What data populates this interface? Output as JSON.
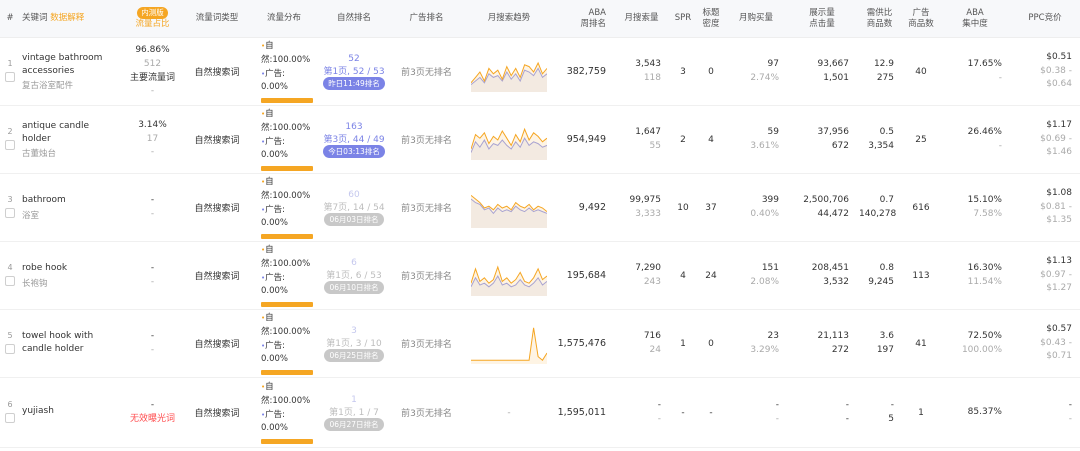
{
  "header": {
    "index": "#",
    "keyword": "关键词",
    "keyword_tag": "数据解释",
    "traffic_share_tag": "内测版",
    "traffic_share": "流量占比",
    "traffic_type": "流量词类型",
    "traffic_dist": "流量分布",
    "organic_rank": "自然排名",
    "ad_rank": "广告排名",
    "monthly_trend": "月搜索趋势",
    "aba_rank_1": "ABA",
    "aba_rank_2": "周排名",
    "monthly_search": "月搜索量",
    "spr": "SPR",
    "title_density_1": "标题",
    "title_density_2": "密度",
    "monthly_purchase": "月购买量",
    "impr_click_1": "展示量",
    "impr_click_2": "点击量",
    "supply_ratio_1": "需供比",
    "supply_ratio_2": "商品数",
    "ad_products_1": "广告",
    "ad_products_2": "商品数",
    "aba_conc_1": "ABA",
    "aba_conc_2": "集中度",
    "ppc": "PPC竞价"
  },
  "rows": [
    {
      "idx": "1",
      "kw": "vintage bathroom accessories",
      "kw_cn": "复古浴室配件",
      "share_pct": "96.86%",
      "share_sub": "512",
      "share_tag": "主要流量词",
      "share_extra": "-",
      "type": "自然搜索词",
      "organic_label": "自然:",
      "organic_pct": "100.00%",
      "ad_label": "广告:",
      "ad_pct": "0.00%",
      "rank_top": "52",
      "rank_page": "第1页, 52 / 53",
      "rank_badge": "昨日11:49排名",
      "ad_rank": "前3页无排名",
      "aba": "382,759",
      "search": "3,543",
      "search_sub": "118",
      "spr": "3",
      "density": "0",
      "purchase": "97",
      "purchase_rate": "2.74%",
      "impr": "93,667",
      "click": "1,501",
      "ratio": "12.9",
      "products": "275",
      "ad_products": "40",
      "conc": "17.65%",
      "conc_sub": "-",
      "ppc": "$0.51",
      "ppc_range": "$0.38 - $0.64"
    },
    {
      "idx": "2",
      "kw": "antique candle holder",
      "kw_cn": "古董烛台",
      "share_pct": "3.14%",
      "share_sub": "17",
      "share_tag": "",
      "share_extra": "-",
      "type": "自然搜索词",
      "organic_label": "自然:",
      "organic_pct": "100.00%",
      "ad_label": "广告:",
      "ad_pct": "0.00%",
      "rank_top": "163",
      "rank_page": "第3页, 44 / 49",
      "rank_badge": "今日03:13排名",
      "ad_rank": "前3页无排名",
      "aba": "954,949",
      "search": "1,647",
      "search_sub": "55",
      "spr": "2",
      "density": "4",
      "purchase": "59",
      "purchase_rate": "3.61%",
      "impr": "37,956",
      "click": "672",
      "ratio": "0.5",
      "products": "3,354",
      "ad_products": "25",
      "conc": "26.46%",
      "conc_sub": "-",
      "ppc": "$1.17",
      "ppc_range": "$0.69 - $1.46"
    },
    {
      "idx": "3",
      "kw": "bathroom",
      "kw_cn": "浴室",
      "share_pct": "-",
      "share_sub": "",
      "share_tag": "",
      "share_extra": "-",
      "type": "自然搜索词",
      "organic_label": "自然:",
      "organic_pct": "100.00%",
      "ad_label": "广告:",
      "ad_pct": "0.00%",
      "rank_top": "60",
      "rank_page": "第7页, 14 / 54",
      "rank_badge": "06月03日排名",
      "ad_rank": "前3页无排名",
      "aba": "9,492",
      "search": "99,975",
      "search_sub": "3,333",
      "spr": "10",
      "density": "37",
      "purchase": "399",
      "purchase_rate": "0.40%",
      "impr": "2,500,706",
      "click": "44,472",
      "ratio": "0.7",
      "products": "140,278",
      "ad_products": "616",
      "conc": "15.10%",
      "conc_sub": "7.58%",
      "ppc": "$1.08",
      "ppc_range": "$0.81 - $1.35"
    },
    {
      "idx": "4",
      "kw": "robe hook",
      "kw_cn": "长袍钩",
      "share_pct": "-",
      "share_sub": "",
      "share_tag": "",
      "share_extra": "-",
      "type": "自然搜索词",
      "organic_label": "自然:",
      "organic_pct": "100.00%",
      "ad_label": "广告:",
      "ad_pct": "0.00%",
      "rank_top": "6",
      "rank_page": "第1页, 6 / 53",
      "rank_badge": "06月10日排名",
      "ad_rank": "前3页无排名",
      "aba": "195,684",
      "search": "7,290",
      "search_sub": "243",
      "spr": "4",
      "density": "24",
      "purchase": "151",
      "purchase_rate": "2.08%",
      "impr": "208,451",
      "click": "3,532",
      "ratio": "0.8",
      "products": "9,245",
      "ad_products": "113",
      "conc": "16.30%",
      "conc_sub": "11.54%",
      "ppc": "$1.13",
      "ppc_range": "$0.97 - $1.27"
    },
    {
      "idx": "5",
      "kw": "towel hook with candle holder",
      "kw_cn": "",
      "share_pct": "-",
      "share_sub": "",
      "share_tag": "",
      "share_extra": "-",
      "type": "自然搜索词",
      "organic_label": "自然:",
      "organic_pct": "100.00%",
      "ad_label": "广告:",
      "ad_pct": "0.00%",
      "rank_top": "3",
      "rank_page": "第1页, 3 / 10",
      "rank_badge": "06月25日排名",
      "ad_rank": "前3页无排名",
      "aba": "1,575,476",
      "search": "716",
      "search_sub": "24",
      "spr": "1",
      "density": "0",
      "purchase": "23",
      "purchase_rate": "3.29%",
      "impr": "21,113",
      "click": "272",
      "ratio": "3.6",
      "products": "197",
      "ad_products": "41",
      "conc": "72.50%",
      "conc_sub": "100.00%",
      "ppc": "$0.57",
      "ppc_range": "$0.43 - $0.71"
    },
    {
      "idx": "6",
      "kw": "yujiash",
      "kw_cn": "",
      "share_pct": "-",
      "share_sub": "",
      "share_tag": "无效曝光词",
      "share_extra": "",
      "type": "自然搜索词",
      "organic_label": "自然:",
      "organic_pct": "100.00%",
      "ad_label": "广告:",
      "ad_pct": "0.00%",
      "rank_top": "1",
      "rank_page": "第1页, 1 / 7",
      "rank_badge": "06月27日排名",
      "ad_rank": "前3页无排名",
      "trend_dash": "-",
      "aba": "1,595,011",
      "search": "-",
      "search_sub": "-",
      "spr": "-",
      "density": "-",
      "purchase": "-",
      "purchase_rate": "-",
      "impr": "-",
      "click": "-",
      "ratio": "-",
      "products": "5",
      "ad_products": "1",
      "conc": "85.37%",
      "conc_sub": "",
      "ppc": "-",
      "ppc_range": "-"
    }
  ],
  "colors": {
    "orange": "#f5a623",
    "purple": "#7b83e6",
    "trend_orange": "#f5a623",
    "trend_purple": "#9ea3ea",
    "red": "#ff4d4f"
  },
  "trend_series": {
    "row1": {
      "orange": [
        8,
        14,
        20,
        10,
        24,
        18,
        22,
        12,
        26,
        16,
        24,
        14,
        28,
        26,
        20,
        30,
        18,
        24
      ],
      "purple": [
        6,
        10,
        14,
        8,
        18,
        14,
        16,
        10,
        20,
        12,
        18,
        10,
        22,
        20,
        16,
        24,
        14,
        18
      ]
    },
    "row2": {
      "orange": [
        10,
        26,
        22,
        28,
        16,
        24,
        20,
        30,
        22,
        14,
        26,
        18,
        32,
        20,
        28,
        24,
        18,
        22
      ],
      "purple": [
        6,
        18,
        12,
        20,
        10,
        16,
        14,
        20,
        14,
        10,
        18,
        12,
        22,
        14,
        18,
        16,
        12,
        14
      ]
    },
    "row3": {
      "orange": [
        34,
        30,
        26,
        20,
        22,
        18,
        24,
        20,
        22,
        18,
        26,
        22,
        20,
        24,
        18,
        22,
        20,
        16
      ],
      "purple": [
        30,
        26,
        24,
        18,
        20,
        14,
        20,
        16,
        18,
        16,
        22,
        18,
        16,
        20,
        16,
        18,
        16,
        14
      ]
    },
    "row4": {
      "orange": [
        12,
        28,
        14,
        18,
        12,
        16,
        30,
        14,
        18,
        12,
        16,
        24,
        14,
        12,
        18,
        28,
        16,
        20
      ],
      "purple": [
        8,
        18,
        10,
        12,
        8,
        12,
        20,
        10,
        12,
        8,
        10,
        16,
        10,
        8,
        12,
        18,
        10,
        14
      ]
    },
    "row5": {
      "orange": [
        2,
        2,
        2,
        2,
        2,
        2,
        2,
        2,
        2,
        2,
        2,
        2,
        2,
        2,
        38,
        6,
        2,
        10
      ],
      "purple": []
    }
  }
}
